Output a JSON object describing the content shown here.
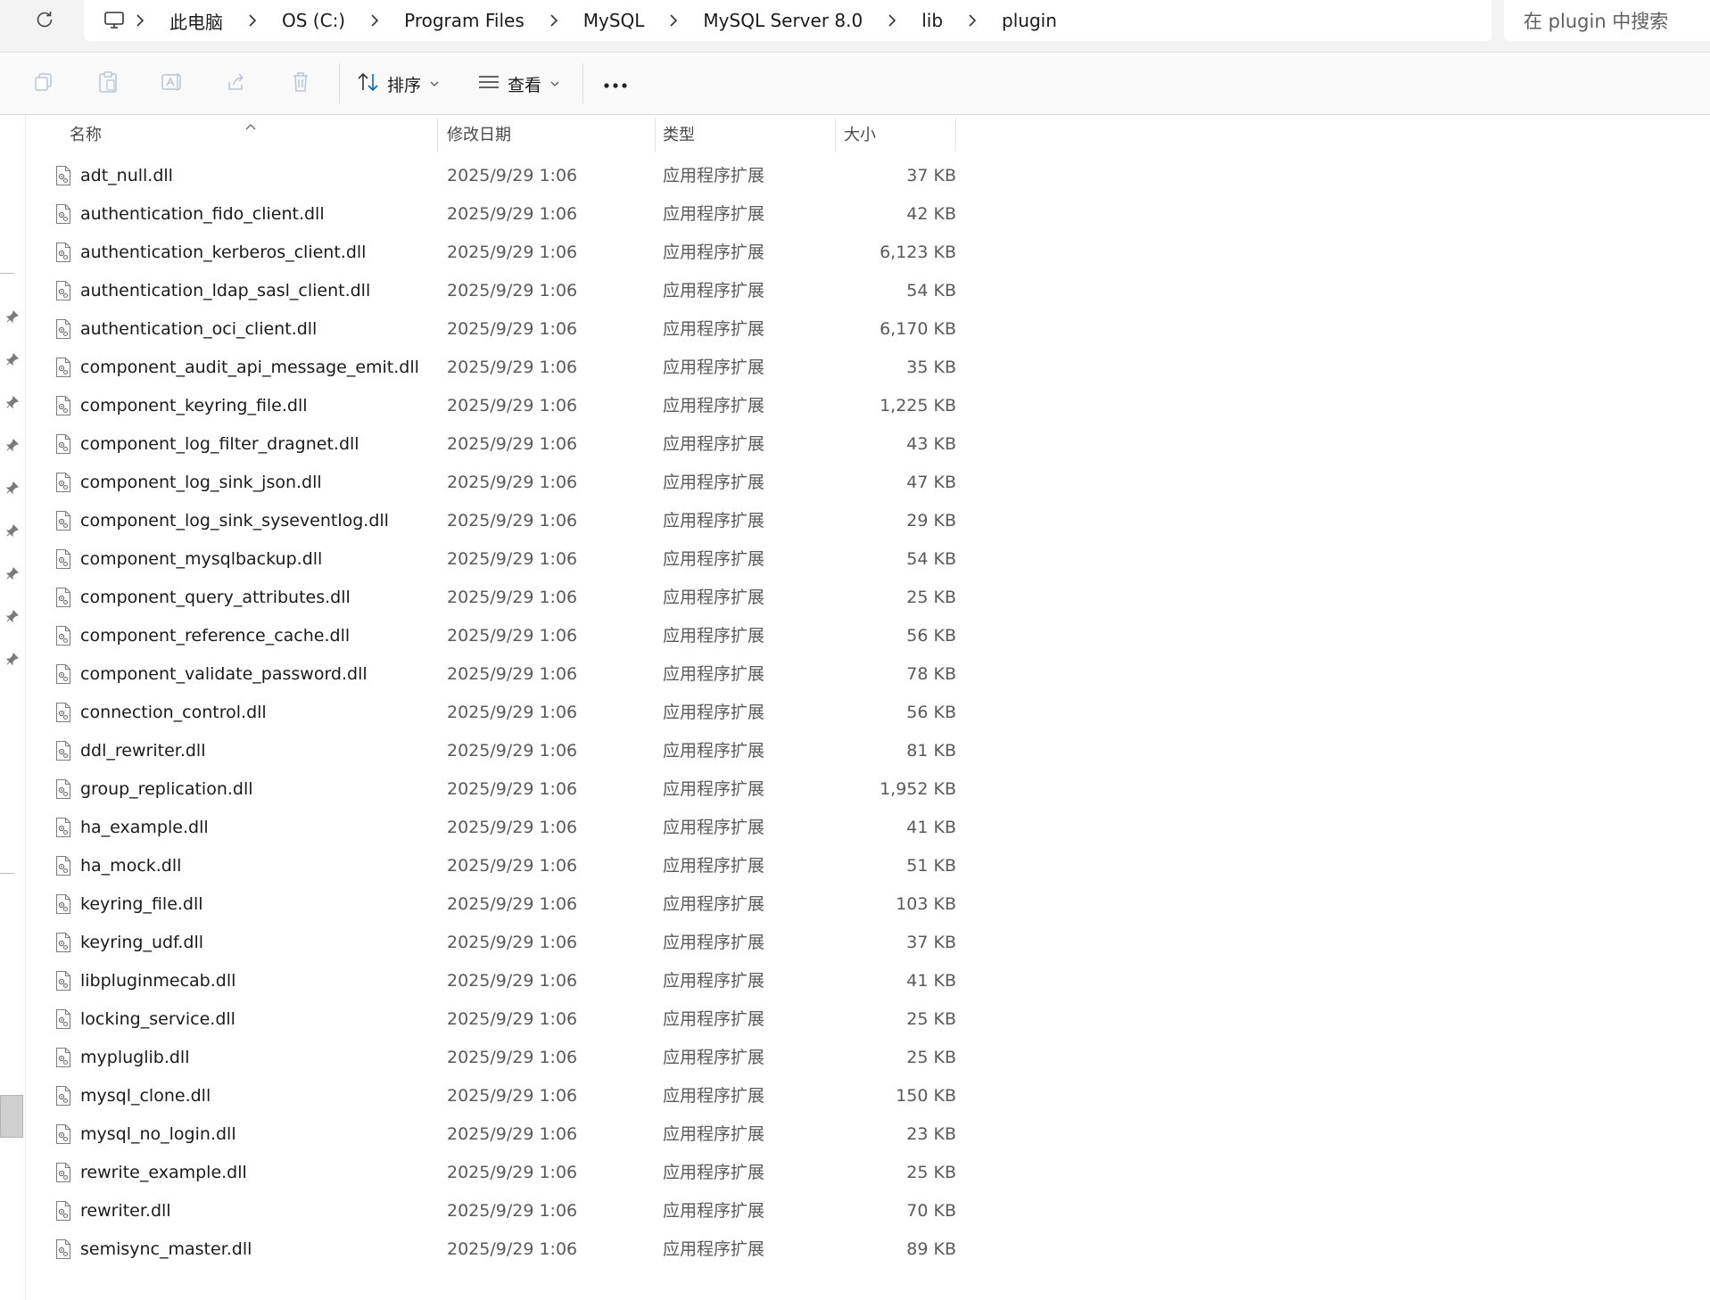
{
  "address_bar": {
    "crumbs": [
      "此电脑",
      "OS (C:)",
      "Program Files",
      "MySQL",
      "MySQL Server 8.0",
      "lib",
      "plugin"
    ],
    "search_placeholder": "在 plugin 中搜索"
  },
  "toolbar": {
    "sort_label": "排序",
    "view_label": "查看"
  },
  "columns": {
    "name": "名称",
    "date": "修改日期",
    "type": "类型",
    "size": "大小"
  },
  "files": [
    {
      "name": "adt_null.dll",
      "date": "2025/9/29 1:06",
      "type": "应用程序扩展",
      "size": "37 KB"
    },
    {
      "name": "authentication_fido_client.dll",
      "date": "2025/9/29 1:06",
      "type": "应用程序扩展",
      "size": "42 KB"
    },
    {
      "name": "authentication_kerberos_client.dll",
      "date": "2025/9/29 1:06",
      "type": "应用程序扩展",
      "size": "6,123 KB"
    },
    {
      "name": "authentication_ldap_sasl_client.dll",
      "date": "2025/9/29 1:06",
      "type": "应用程序扩展",
      "size": "54 KB"
    },
    {
      "name": "authentication_oci_client.dll",
      "date": "2025/9/29 1:06",
      "type": "应用程序扩展",
      "size": "6,170 KB"
    },
    {
      "name": "component_audit_api_message_emit.dll",
      "date": "2025/9/29 1:06",
      "type": "应用程序扩展",
      "size": "35 KB"
    },
    {
      "name": "component_keyring_file.dll",
      "date": "2025/9/29 1:06",
      "type": "应用程序扩展",
      "size": "1,225 KB"
    },
    {
      "name": "component_log_filter_dragnet.dll",
      "date": "2025/9/29 1:06",
      "type": "应用程序扩展",
      "size": "43 KB"
    },
    {
      "name": "component_log_sink_json.dll",
      "date": "2025/9/29 1:06",
      "type": "应用程序扩展",
      "size": "47 KB"
    },
    {
      "name": "component_log_sink_syseventlog.dll",
      "date": "2025/9/29 1:06",
      "type": "应用程序扩展",
      "size": "29 KB"
    },
    {
      "name": "component_mysqlbackup.dll",
      "date": "2025/9/29 1:06",
      "type": "应用程序扩展",
      "size": "54 KB"
    },
    {
      "name": "component_query_attributes.dll",
      "date": "2025/9/29 1:06",
      "type": "应用程序扩展",
      "size": "25 KB"
    },
    {
      "name": "component_reference_cache.dll",
      "date": "2025/9/29 1:06",
      "type": "应用程序扩展",
      "size": "56 KB"
    },
    {
      "name": "component_validate_password.dll",
      "date": "2025/9/29 1:06",
      "type": "应用程序扩展",
      "size": "78 KB"
    },
    {
      "name": "connection_control.dll",
      "date": "2025/9/29 1:06",
      "type": "应用程序扩展",
      "size": "56 KB"
    },
    {
      "name": "ddl_rewriter.dll",
      "date": "2025/9/29 1:06",
      "type": "应用程序扩展",
      "size": "81 KB"
    },
    {
      "name": "group_replication.dll",
      "date": "2025/9/29 1:06",
      "type": "应用程序扩展",
      "size": "1,952 KB"
    },
    {
      "name": "ha_example.dll",
      "date": "2025/9/29 1:06",
      "type": "应用程序扩展",
      "size": "41 KB"
    },
    {
      "name": "ha_mock.dll",
      "date": "2025/9/29 1:06",
      "type": "应用程序扩展",
      "size": "51 KB"
    },
    {
      "name": "keyring_file.dll",
      "date": "2025/9/29 1:06",
      "type": "应用程序扩展",
      "size": "103 KB"
    },
    {
      "name": "keyring_udf.dll",
      "date": "2025/9/29 1:06",
      "type": "应用程序扩展",
      "size": "37 KB"
    },
    {
      "name": "libpluginmecab.dll",
      "date": "2025/9/29 1:06",
      "type": "应用程序扩展",
      "size": "41 KB"
    },
    {
      "name": "locking_service.dll",
      "date": "2025/9/29 1:06",
      "type": "应用程序扩展",
      "size": "25 KB"
    },
    {
      "name": "mypluglib.dll",
      "date": "2025/9/29 1:06",
      "type": "应用程序扩展",
      "size": "25 KB"
    },
    {
      "name": "mysql_clone.dll",
      "date": "2025/9/29 1:06",
      "type": "应用程序扩展",
      "size": "150 KB"
    },
    {
      "name": "mysql_no_login.dll",
      "date": "2025/9/29 1:06",
      "type": "应用程序扩展",
      "size": "23 KB"
    },
    {
      "name": "rewrite_example.dll",
      "date": "2025/9/29 1:06",
      "type": "应用程序扩展",
      "size": "25 KB"
    },
    {
      "name": "rewriter.dll",
      "date": "2025/9/29 1:06",
      "type": "应用程序扩展",
      "size": "70 KB"
    },
    {
      "name": "semisync_master.dll",
      "date": "2025/9/29 1:06",
      "type": "应用程序扩展",
      "size": "89 KB"
    }
  ],
  "colors": {
    "accent": "#0067c0",
    "chrome_bg": "#f3f3f3",
    "toolbar_bg": "#f9f9f9",
    "secondary_text": "#5a5a5a"
  }
}
